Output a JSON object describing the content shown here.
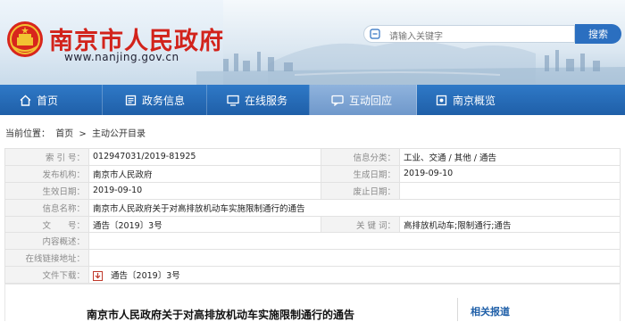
{
  "header": {
    "site_title": "南京市人民政府",
    "site_url": "www.nanjing.gov.cn",
    "search_placeholder": "请输入关键字",
    "search_button": "搜索"
  },
  "nav": {
    "items": [
      {
        "label": "首页",
        "icon": "home-icon"
      },
      {
        "label": "政务信息",
        "icon": "news-icon"
      },
      {
        "label": "在线服务",
        "icon": "monitor-icon"
      },
      {
        "label": "互动回应",
        "icon": "chat-icon"
      },
      {
        "label": "南京概览",
        "icon": "overview-icon"
      }
    ],
    "active_index": 3
  },
  "breadcrumb": {
    "prefix": "当前位置：",
    "home": "首页",
    "sep": ">",
    "current": "主动公开目录"
  },
  "info": {
    "index_label": "索 引 号：",
    "index_value": "012947031/2019-81925",
    "category_label": "信息分类：",
    "category_value": "工业、交通 / 其他 / 通告",
    "publisher_label": "发布机构：",
    "publisher_value": "南京市人民政府",
    "created_label": "生成日期：",
    "created_value": "2019-09-10",
    "effective_label": "生效日期：",
    "effective_value": "2019-09-10",
    "expired_label": "废止日期：",
    "expired_value": "",
    "name_label": "信息名称：",
    "name_value": "南京市人民政府关于对高排放机动车实施限制通行的通告",
    "docno_label": "文　　号：",
    "docno_value": "通告〔2019〕3号",
    "keywords_label": "关 键 词：",
    "keywords_value": "高排放机动车;限制通行;通告",
    "summary_label": "内容概述：",
    "summary_value": "",
    "link_label": "在线链接地址：",
    "link_value": "",
    "download_label": "文件下载：",
    "download_value": "通告〔2019〕3号"
  },
  "content": {
    "title": "南京市人民政府关于对高排放机动车实施限制通行的通告",
    "related_heading": "相关报道"
  },
  "colors": {
    "title_red": "#d2231b",
    "nav_blue": "#1f5fa8",
    "active_tab": "#7ea5d4"
  }
}
